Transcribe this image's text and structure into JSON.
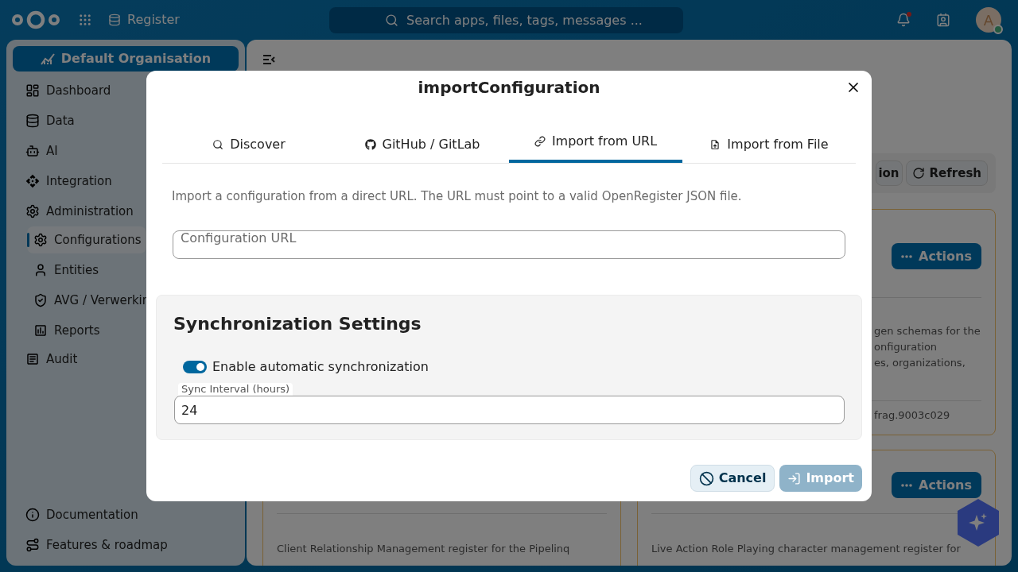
{
  "header": {
    "app_name": "Register",
    "search": {
      "placeholder": "Search apps, files, tags, messages ..."
    },
    "notifications_unread": true,
    "avatar": {
      "initial": "A",
      "online": true
    }
  },
  "sidebar": {
    "organisation": "Default Organisation",
    "items": [
      {
        "label": "Dashboard",
        "selected": false
      },
      {
        "label": "Data",
        "selected": false
      },
      {
        "label": "AI",
        "selected": false
      },
      {
        "label": "Integration",
        "selected": false
      },
      {
        "label": "Administration",
        "selected": false,
        "children": [
          {
            "label": "Configurations",
            "selected": true
          },
          {
            "label": "Entities",
            "selected": false
          },
          {
            "label": "AVG / Verwerkin",
            "selected": false
          },
          {
            "label": "Reports",
            "selected": false
          }
        ]
      },
      {
        "label": "Audit",
        "selected": false
      }
    ],
    "footer_items": [
      {
        "label": "Documentation"
      },
      {
        "label": "Features & roadmap"
      }
    ]
  },
  "page": {
    "toolbar": [
      {
        "label": "ion"
      },
      {
        "label": "Refresh"
      }
    ],
    "cards": [
      {
        "actions": "Actions",
        "description": [
          "gen schemas for the",
          "onfiguration",
          "es, organizations,"
        ],
        "footer": "frag.9003c029"
      },
      {
        "description": [
          "Client Relationship Management register for the Pipelinq"
        ]
      },
      {
        "actions": "Actions",
        "description": [
          "Live Action Role Playing character management register for"
        ]
      }
    ]
  },
  "dialog": {
    "title": "importConfiguration",
    "tabs": [
      {
        "label": "Discover",
        "selected": false
      },
      {
        "label": "GitHub / GitLab",
        "selected": false
      },
      {
        "label": "Import from URL",
        "selected": true
      },
      {
        "label": "Import from File",
        "selected": false
      }
    ],
    "description": "Import a configuration from a direct URL. The URL must point to a valid OpenRegister JSON file.",
    "url_field": {
      "label": "Configuration URL"
    },
    "sync": {
      "title": "Synchronization Settings",
      "auto_sync": {
        "label": "Enable automatic synchronization",
        "on": true
      },
      "interval": {
        "label": "Sync Interval (hours)",
        "value": "24"
      }
    },
    "buttons": [
      {
        "label": "Cancel",
        "kind": "secondary",
        "disabled": false
      },
      {
        "label": "Import",
        "kind": "primary",
        "disabled": true
      }
    ]
  }
}
